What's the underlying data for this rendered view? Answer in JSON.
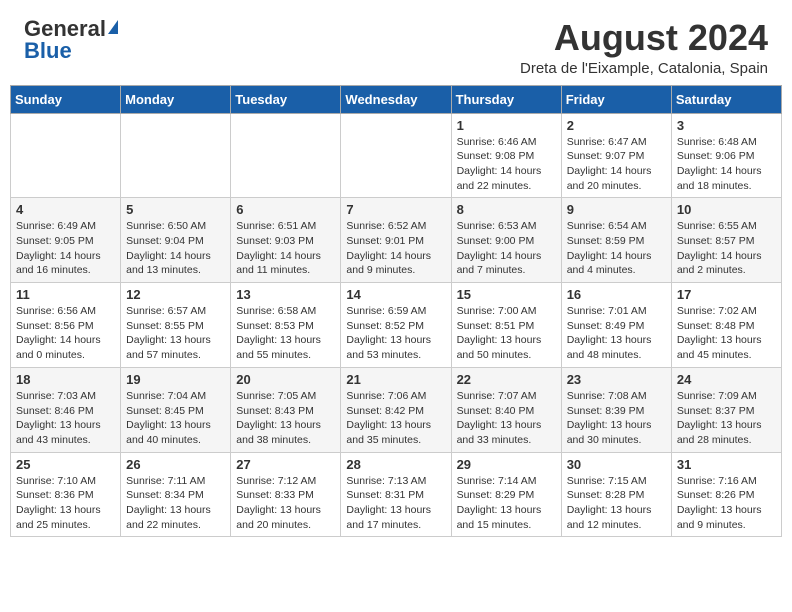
{
  "header": {
    "logo_general": "General",
    "logo_blue": "Blue",
    "month_title": "August 2024",
    "subtitle": "Dreta de l'Eixample, Catalonia, Spain"
  },
  "weekdays": [
    "Sunday",
    "Monday",
    "Tuesday",
    "Wednesday",
    "Thursday",
    "Friday",
    "Saturday"
  ],
  "weeks": [
    [
      {
        "day": "",
        "info": ""
      },
      {
        "day": "",
        "info": ""
      },
      {
        "day": "",
        "info": ""
      },
      {
        "day": "",
        "info": ""
      },
      {
        "day": "1",
        "info": "Sunrise: 6:46 AM\nSunset: 9:08 PM\nDaylight: 14 hours\nand 22 minutes."
      },
      {
        "day": "2",
        "info": "Sunrise: 6:47 AM\nSunset: 9:07 PM\nDaylight: 14 hours\nand 20 minutes."
      },
      {
        "day": "3",
        "info": "Sunrise: 6:48 AM\nSunset: 9:06 PM\nDaylight: 14 hours\nand 18 minutes."
      }
    ],
    [
      {
        "day": "4",
        "info": "Sunrise: 6:49 AM\nSunset: 9:05 PM\nDaylight: 14 hours\nand 16 minutes."
      },
      {
        "day": "5",
        "info": "Sunrise: 6:50 AM\nSunset: 9:04 PM\nDaylight: 14 hours\nand 13 minutes."
      },
      {
        "day": "6",
        "info": "Sunrise: 6:51 AM\nSunset: 9:03 PM\nDaylight: 14 hours\nand 11 minutes."
      },
      {
        "day": "7",
        "info": "Sunrise: 6:52 AM\nSunset: 9:01 PM\nDaylight: 14 hours\nand 9 minutes."
      },
      {
        "day": "8",
        "info": "Sunrise: 6:53 AM\nSunset: 9:00 PM\nDaylight: 14 hours\nand 7 minutes."
      },
      {
        "day": "9",
        "info": "Sunrise: 6:54 AM\nSunset: 8:59 PM\nDaylight: 14 hours\nand 4 minutes."
      },
      {
        "day": "10",
        "info": "Sunrise: 6:55 AM\nSunset: 8:57 PM\nDaylight: 14 hours\nand 2 minutes."
      }
    ],
    [
      {
        "day": "11",
        "info": "Sunrise: 6:56 AM\nSunset: 8:56 PM\nDaylight: 14 hours\nand 0 minutes."
      },
      {
        "day": "12",
        "info": "Sunrise: 6:57 AM\nSunset: 8:55 PM\nDaylight: 13 hours\nand 57 minutes."
      },
      {
        "day": "13",
        "info": "Sunrise: 6:58 AM\nSunset: 8:53 PM\nDaylight: 13 hours\nand 55 minutes."
      },
      {
        "day": "14",
        "info": "Sunrise: 6:59 AM\nSunset: 8:52 PM\nDaylight: 13 hours\nand 53 minutes."
      },
      {
        "day": "15",
        "info": "Sunrise: 7:00 AM\nSunset: 8:51 PM\nDaylight: 13 hours\nand 50 minutes."
      },
      {
        "day": "16",
        "info": "Sunrise: 7:01 AM\nSunset: 8:49 PM\nDaylight: 13 hours\nand 48 minutes."
      },
      {
        "day": "17",
        "info": "Sunrise: 7:02 AM\nSunset: 8:48 PM\nDaylight: 13 hours\nand 45 minutes."
      }
    ],
    [
      {
        "day": "18",
        "info": "Sunrise: 7:03 AM\nSunset: 8:46 PM\nDaylight: 13 hours\nand 43 minutes."
      },
      {
        "day": "19",
        "info": "Sunrise: 7:04 AM\nSunset: 8:45 PM\nDaylight: 13 hours\nand 40 minutes."
      },
      {
        "day": "20",
        "info": "Sunrise: 7:05 AM\nSunset: 8:43 PM\nDaylight: 13 hours\nand 38 minutes."
      },
      {
        "day": "21",
        "info": "Sunrise: 7:06 AM\nSunset: 8:42 PM\nDaylight: 13 hours\nand 35 minutes."
      },
      {
        "day": "22",
        "info": "Sunrise: 7:07 AM\nSunset: 8:40 PM\nDaylight: 13 hours\nand 33 minutes."
      },
      {
        "day": "23",
        "info": "Sunrise: 7:08 AM\nSunset: 8:39 PM\nDaylight: 13 hours\nand 30 minutes."
      },
      {
        "day": "24",
        "info": "Sunrise: 7:09 AM\nSunset: 8:37 PM\nDaylight: 13 hours\nand 28 minutes."
      }
    ],
    [
      {
        "day": "25",
        "info": "Sunrise: 7:10 AM\nSunset: 8:36 PM\nDaylight: 13 hours\nand 25 minutes."
      },
      {
        "day": "26",
        "info": "Sunrise: 7:11 AM\nSunset: 8:34 PM\nDaylight: 13 hours\nand 22 minutes."
      },
      {
        "day": "27",
        "info": "Sunrise: 7:12 AM\nSunset: 8:33 PM\nDaylight: 13 hours\nand 20 minutes."
      },
      {
        "day": "28",
        "info": "Sunrise: 7:13 AM\nSunset: 8:31 PM\nDaylight: 13 hours\nand 17 minutes."
      },
      {
        "day": "29",
        "info": "Sunrise: 7:14 AM\nSunset: 8:29 PM\nDaylight: 13 hours\nand 15 minutes."
      },
      {
        "day": "30",
        "info": "Sunrise: 7:15 AM\nSunset: 8:28 PM\nDaylight: 13 hours\nand 12 minutes."
      },
      {
        "day": "31",
        "info": "Sunrise: 7:16 AM\nSunset: 8:26 PM\nDaylight: 13 hours\nand 9 minutes."
      }
    ]
  ]
}
